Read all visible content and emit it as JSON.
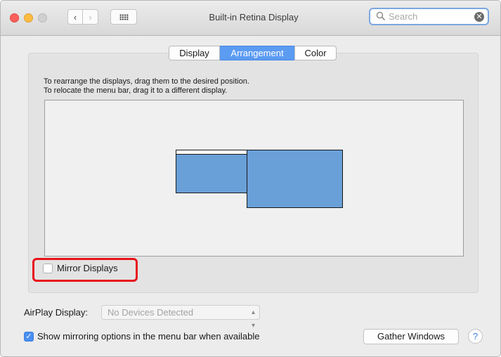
{
  "window": {
    "title": "Built-in Retina Display"
  },
  "toolbar": {
    "back_icon": "chevron-left-icon",
    "forward_icon": "chevron-right-icon",
    "show_all_icon": "grid-icon"
  },
  "search": {
    "placeholder": "Search",
    "clear_icon": "clear-circle-icon"
  },
  "tabs": [
    {
      "label": "Display",
      "selected": false
    },
    {
      "label": "Arrangement",
      "selected": true
    },
    {
      "label": "Color",
      "selected": false
    }
  ],
  "instructions": {
    "line1": "To rearrange the displays, drag them to the desired position.",
    "line2": "To relocate the menu bar, drag it to a different display."
  },
  "mirror": {
    "label": "Mirror Displays",
    "checked": false
  },
  "airplay": {
    "label": "AirPlay Display:",
    "selected": "No Devices Detected"
  },
  "show_mirroring": {
    "label": "Show mirroring options in the menu bar when available",
    "checked": true
  },
  "buttons": {
    "gather": "Gather Windows",
    "help": "?"
  },
  "colors": {
    "accent": "#5b9bf2",
    "display_fill": "#6aa0d8",
    "highlight": "#e8141b"
  }
}
